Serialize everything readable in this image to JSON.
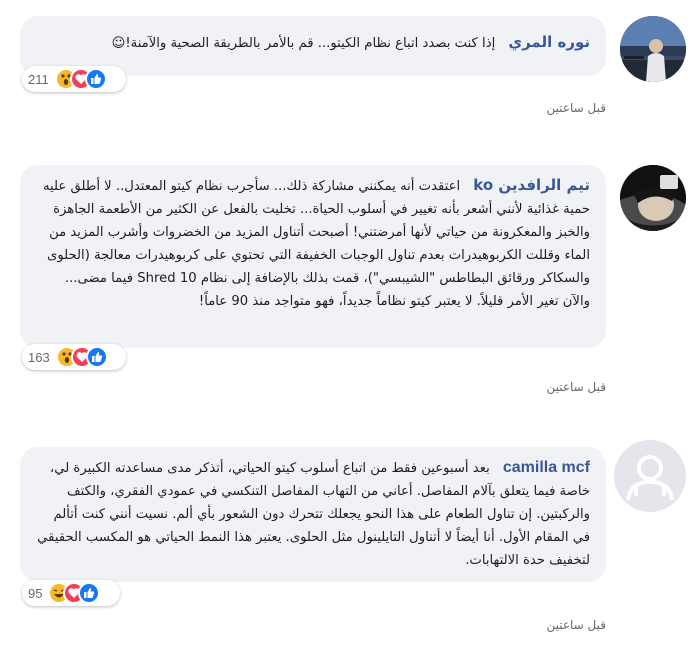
{
  "comments": [
    {
      "author": "نوره المري",
      "text": "إذا كنت بصدد اتباع نظام الكيتو... قم بالأمر بالطريقة الصحية والآمنة!☺",
      "reaction_count": "211",
      "time": "قبل ساعتين",
      "reactions": [
        "wow",
        "love",
        "like"
      ]
    },
    {
      "author": "تيم الرافدين ko",
      "text": "اعتقدت أنه يمكنني مشاركة ذلك... سأجرب نظام كيتو المعتدل.. لا أطلق عليه حمية غذائية لأنني أشعر بأنه تغيير في أسلوب الحياة... تخليت بالفعل عن الكثير من الأطعمة الجاهزة والخبز والمعكرونة من حياتي لأنها أمرضتني! أصبحت أتناول المزيد من الخضروات وأشرب المزيد من الماء وقللت الكربوهيدرات بعدم تناول الوجبات الخفيفة التي تحتوي على كربوهيدرات معالجة (الحلوى والسكاكر ورقائق البطاطس \"الشيبسي\")، قمت بذلك بالإضافة إلى نظام Shred 10 فيما مضى... والآن تغير الأمر قليلاً. لا يعتبر كيتو نظاماً جديداً، فهو متواجد منذ 90 عاماً!",
      "reaction_count": "163",
      "time": "قبل ساعتين",
      "reactions": [
        "wow",
        "love",
        "like"
      ]
    },
    {
      "author": "camilla mcf",
      "text": "بعد أسبوعين فقط من اتباع أسلوب كيتو الحياتي، أتذكر مدى مساعدته الكبيرة لي، خاصة فيما يتعلق بآلام المفاصل. أعاني من التهاب المفاصل التنكسي في عمودي الفقري، والكتف والركبتين. إن تناول الطعام على هذا النحو يجعلك تتحرك دون الشعور بأي ألم. نسيت أنني كنت أتألم في المقام الأول. أنا أيضاً لا أتناول التايلينول مثل الحلوى. يعتبر هذا النمط الحياتي هو المكسب الحقيقي لتخفيف حدة الالتهابات.",
      "reaction_count": "95",
      "time": "قبل ساعتين",
      "reactions": [
        "haha",
        "love",
        "like"
      ]
    }
  ],
  "colors": {
    "bubble": "#f0f2f5",
    "author": "#385898",
    "like": "#1877f2",
    "love": "#f33e58",
    "wow": "#f7b928"
  }
}
